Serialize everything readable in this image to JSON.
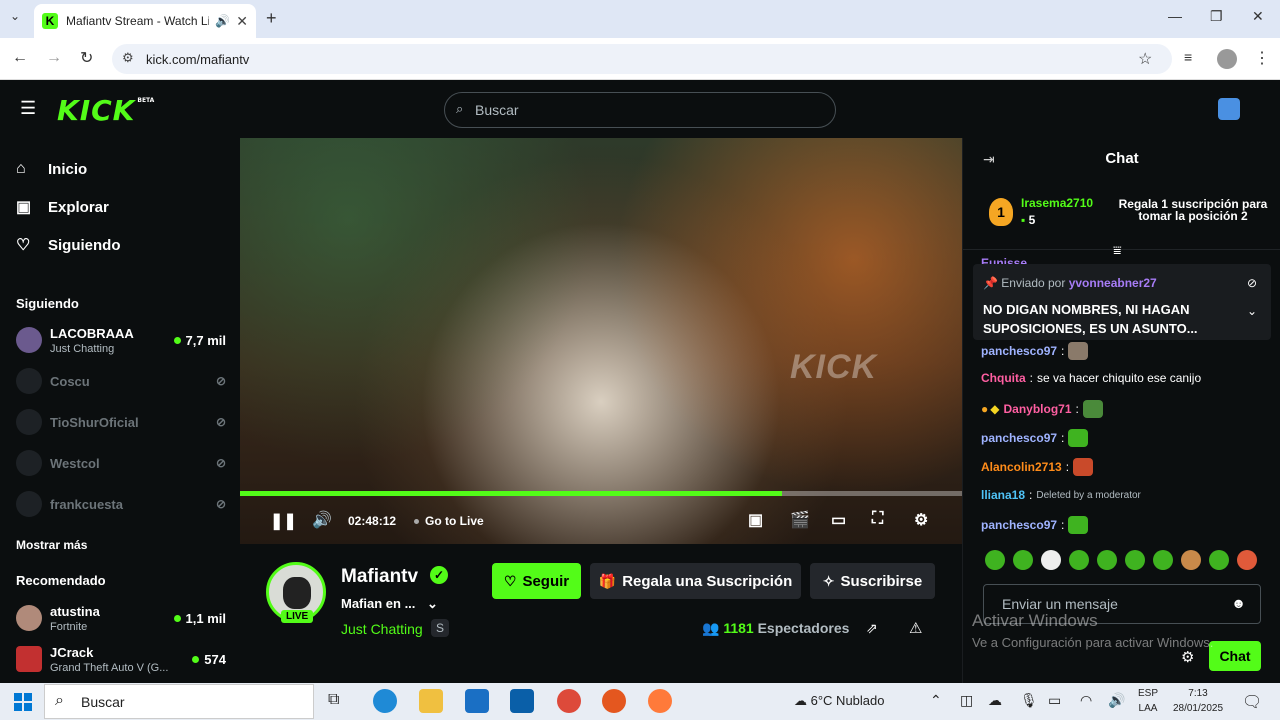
{
  "browser": {
    "tab_title": "Mafiantv Stream - Watch Li",
    "url": "kick.com/mafiantv"
  },
  "header": {
    "logo": "KICK",
    "logo_badge": "BETA",
    "search_placeholder": "Buscar"
  },
  "sidebar": {
    "nav": [
      {
        "label": "Inicio",
        "icon": "home-icon"
      },
      {
        "label": "Explorar",
        "icon": "compass-icon"
      },
      {
        "label": "Siguiendo",
        "icon": "heart-icon"
      }
    ],
    "following_title": "Siguiendo",
    "following": [
      {
        "name": "LACOBRAAA",
        "category": "Just Chatting",
        "viewers": "7,7 mil",
        "live": true
      },
      {
        "name": "Coscu",
        "live": false
      },
      {
        "name": "TioShurOficial",
        "live": false
      },
      {
        "name": "Westcol",
        "live": false
      },
      {
        "name": "frankcuesta",
        "live": false
      }
    ],
    "show_more": "Mostrar más",
    "recommended_title": "Recomendado",
    "recommended": [
      {
        "name": "atustina",
        "category": "Fortnite",
        "viewers": "1,1 mil"
      },
      {
        "name": "JCrack",
        "category": "Grand Theft Auto V (G...",
        "viewers": "574"
      }
    ]
  },
  "player": {
    "watermark": "KICK",
    "elapsed": "02:48:12",
    "go_live": "Go to Live",
    "progress": 0.75
  },
  "stream": {
    "name": "Mafiantv",
    "live_badge": "LIVE",
    "title": "Mafian en ...",
    "category": "Just Chatting",
    "tag": "S",
    "follow": "Seguir",
    "gift_sub": "Regala una Suscripción",
    "subscribe": "Suscribirse",
    "viewers_count": "1181",
    "viewers_label": "Espectadores"
  },
  "chat": {
    "title": "Chat",
    "leader": {
      "rank": "1",
      "user": "Irasema2710",
      "count": "5",
      "gift_text": "Regala 1 suscripción para tomar la posición 2"
    },
    "pinned": {
      "sent_by_label": "Enviado por",
      "user": "yvonneabner27",
      "message": "NO DIGAN NOMBRES, NI HAGAN SUPOSICIONES, ES UN ASUNTO..."
    },
    "cut_user": "Eunisse",
    "messages": [
      {
        "user": "panchesco97",
        "text": "",
        "color": "#9fb3ff"
      },
      {
        "user": "Chquita",
        "text": "se va hacer chiquito ese canijo",
        "color": "#ff5fa2"
      },
      {
        "user": "Danyblog71",
        "text": "",
        "color": "#ff5fa2"
      },
      {
        "user": "panchesco97",
        "text": "",
        "color": "#9fb3ff"
      },
      {
        "user": "Alancolin2713",
        "text": "",
        "color": "#ff8c1a"
      },
      {
        "user": "lliana18",
        "text": "Deleted by a moderator",
        "color": "#4fc3f7"
      },
      {
        "user": "panchesco97",
        "text": "",
        "color": "#9fb3ff"
      }
    ],
    "input_placeholder": "Enviar un mensaje",
    "send_label": "Chat"
  },
  "windows_watermark": {
    "line1": "Activar Windows",
    "line2": "Ve a Configuración para activar Windows."
  },
  "taskbar": {
    "search_label": "Buscar",
    "weather": "6°C  Nublado",
    "lang_1": "ESP",
    "lang_2": "LAA",
    "time": "7:13",
    "date": "28/01/2025"
  }
}
